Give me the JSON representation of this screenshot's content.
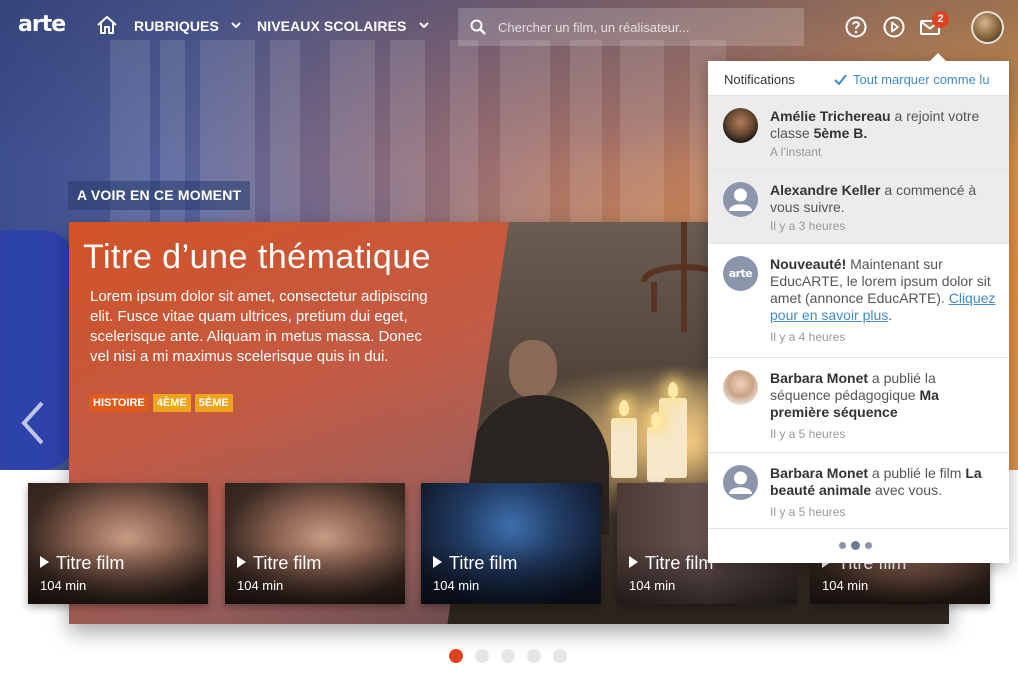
{
  "header": {
    "logo": "arte",
    "nav": [
      {
        "label": "RUBRIQUES"
      },
      {
        "label": "NIVEAUX SCOLAIRES"
      }
    ],
    "search_placeholder": "Chercher un film, un réalisateur...",
    "mail_badge": "2",
    "icons": [
      "home-icon",
      "help-icon",
      "play-circle-icon",
      "mail-icon",
      "user-avatar"
    ]
  },
  "hero": {
    "section_label": "A VOIR EN CE MOMENT",
    "title": "Titre d’une thématique",
    "description": "Lorem ipsum dolor sit amet, consectetur adipiscing elit. Fusce vitae quam ultrices, pretium dui eget, scelerisque ante. Aliquam in metus massa. Donec vel nisi a mi maximus scelerisque quis in dui.",
    "tags": [
      "HISTOIRE",
      "4ÈME",
      "5ÈME"
    ]
  },
  "films": [
    {
      "title": "Titre film",
      "duration": "104 min"
    },
    {
      "title": "Titre film",
      "duration": "104 min"
    },
    {
      "title": "Titre film",
      "duration": "104 min"
    },
    {
      "title": "Titre film",
      "duration": "104 min"
    },
    {
      "title": "Titre film",
      "duration": "104 min"
    }
  ],
  "pagination": {
    "count": 5,
    "active": 1
  },
  "notifications": {
    "title": "Notifications",
    "mark_all": "Tout marquer comme lu",
    "items": [
      {
        "name": "Amélie Trichereau",
        "text": " a rejoint votre classe ",
        "extra": "5ème B.",
        "time": "A l’instant",
        "unread": true
      },
      {
        "name": "Alexandre Keller",
        "text": " a commencé à vous suivre.",
        "time": "Il y a 3 heures",
        "unread": true
      },
      {
        "name": "Nouveauté!",
        "text": " Maintenant sur EducARTE, le lorem ipsum dolor sit amet (annonce EducARTE). ",
        "link": "Cliquez pour en savoir plus",
        "link_end": ".",
        "time": "Il y a 4 heures",
        "unread": false
      },
      {
        "name": "Barbara Monet",
        "text": " a publié la séquence pédagogique ",
        "extra": "Ma première séquence",
        "time": "Il y a 5 heures",
        "unread": false
      },
      {
        "name": "Barbara Monet",
        "text": " a publié le film ",
        "extra": "La beauté animale",
        "extra_end": " avec vous.",
        "time": "Il y a 5 heures",
        "unread": false
      }
    ]
  },
  "colors": {
    "accent": "#e0411f",
    "link": "#3f8cc8",
    "tag_orange": "#e05a1c",
    "tag_yellow": "#f0a21a"
  }
}
